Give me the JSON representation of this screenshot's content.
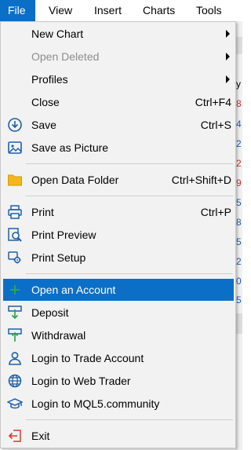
{
  "menubar": {
    "items": [
      "File",
      "View",
      "Insert",
      "Charts",
      "Tools"
    ]
  },
  "background": {
    "rows": [
      {
        "text": "y",
        "color": "#000000"
      },
      {
        "text": "8",
        "color": "#d0302a"
      },
      {
        "text": "4",
        "color": "#1a5cc8"
      },
      {
        "text": "2",
        "color": "#1a5cc8"
      },
      {
        "text": "2",
        "color": "#d0302a"
      },
      {
        "text": "9",
        "color": "#d0302a"
      },
      {
        "text": "5",
        "color": "#1a5cc8"
      },
      {
        "text": "8",
        "color": "#1a5cc8"
      },
      {
        "text": "5",
        "color": "#1a5cc8"
      },
      {
        "text": "2",
        "color": "#1a5cc8"
      },
      {
        "text": "0",
        "color": "#1a5cc8"
      },
      {
        "text": "5",
        "color": "#1a5cc8"
      }
    ]
  },
  "menu": {
    "new_chart": {
      "label": "New Chart"
    },
    "open_deleted": {
      "label": "Open Deleted"
    },
    "profiles": {
      "label": "Profiles"
    },
    "close": {
      "label": "Close",
      "shortcut": "Ctrl+F4"
    },
    "save": {
      "label": "Save",
      "shortcut": "Ctrl+S",
      "icon": "save-icon"
    },
    "save_picture": {
      "label": "Save as Picture",
      "icon": "picture-icon"
    },
    "open_data_folder": {
      "label": "Open Data Folder",
      "shortcut": "Ctrl+Shift+D",
      "icon": "folder-icon"
    },
    "print": {
      "label": "Print",
      "shortcut": "Ctrl+P",
      "icon": "printer-icon"
    },
    "print_preview": {
      "label": "Print Preview",
      "icon": "print-preview-icon"
    },
    "print_setup": {
      "label": "Print Setup",
      "icon": "print-setup-icon"
    },
    "open_account": {
      "label": "Open an Account",
      "icon": "plus-icon"
    },
    "deposit": {
      "label": "Deposit",
      "icon": "deposit-icon"
    },
    "withdrawal": {
      "label": "Withdrawal",
      "icon": "withdrawal-icon"
    },
    "login_trade": {
      "label": "Login to Trade Account",
      "icon": "user-icon"
    },
    "login_web": {
      "label": "Login to Web Trader",
      "icon": "globe-icon"
    },
    "login_mql5": {
      "label": "Login to MQL5.community",
      "icon": "graduation-cap-icon"
    },
    "exit": {
      "label": "Exit",
      "icon": "exit-icon"
    }
  },
  "colors": {
    "accent": "#0b6fc7",
    "icon_blue": "#1f5fa8",
    "folder": "#f2b81a",
    "plus": "#2aa84a",
    "exit": "#d33a2c"
  }
}
